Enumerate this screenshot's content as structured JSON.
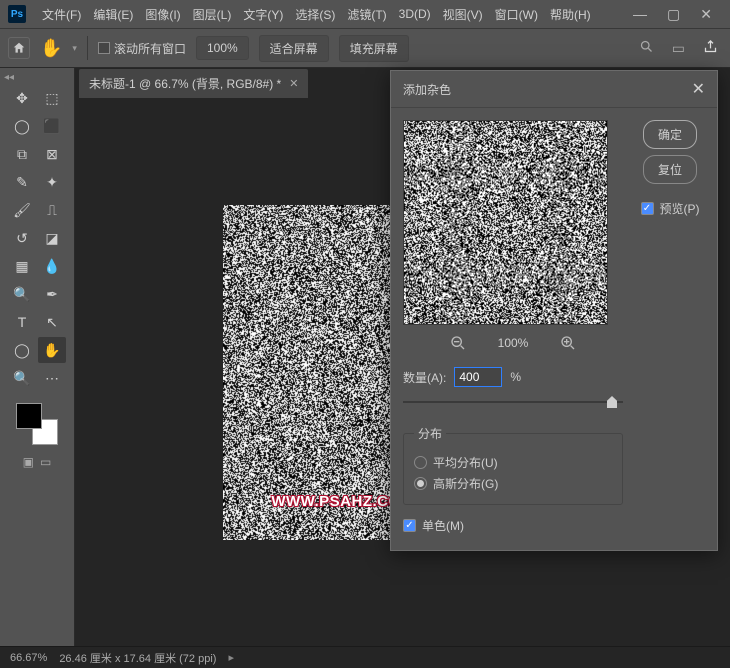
{
  "app": {
    "icon_text": "Ps"
  },
  "menu": [
    "文件(F)",
    "编辑(E)",
    "图像(I)",
    "图层(L)",
    "文字(Y)",
    "选择(S)",
    "滤镜(T)",
    "3D(D)",
    "视图(V)",
    "窗口(W)",
    "帮助(H)"
  ],
  "window_controls": {
    "min": "—",
    "max": "▢",
    "close": "✕"
  },
  "optbar": {
    "scroll_all": "滚动所有窗口",
    "zoom_pct": "100%",
    "fit_screen": "适合屏幕",
    "fill_screen": "填充屏幕"
  },
  "tab": {
    "title": "未标题-1 @ 66.7% (背景, RGB/8#) *"
  },
  "canvas": {
    "watermark": "WWW.PSAHZ.COM"
  },
  "status": {
    "zoom": "66.67%",
    "dims": "26.46 厘米 x 17.64 厘米 (72 ppi)"
  },
  "dialog": {
    "title": "添加杂色",
    "ok": "确定",
    "reset": "复位",
    "preview": "预览(P)",
    "zoom_pct": "100%",
    "amount_label": "数量(A):",
    "amount_value": "400",
    "amount_unit": "%",
    "dist_legend": "分布",
    "uniform": "平均分布(U)",
    "gaussian": "高斯分布(G)",
    "mono": "单色(M)"
  },
  "tools": {
    "row0": [
      "move",
      "square-marquee"
    ],
    "row1": [
      "lasso",
      "magic-wand"
    ],
    "row2": [
      "crop",
      "frame"
    ],
    "row3": [
      "eyedropper",
      "healing"
    ],
    "row4": [
      "brush",
      "clone"
    ],
    "row5": [
      "history",
      "eraser"
    ],
    "row6": [
      "gradient",
      "blur"
    ],
    "row7": [
      "dodge",
      "pen"
    ],
    "row8": [
      "type",
      "path-select"
    ],
    "row9": [
      "ellipse",
      "hand"
    ],
    "row10": [
      "zoom",
      "more"
    ]
  }
}
